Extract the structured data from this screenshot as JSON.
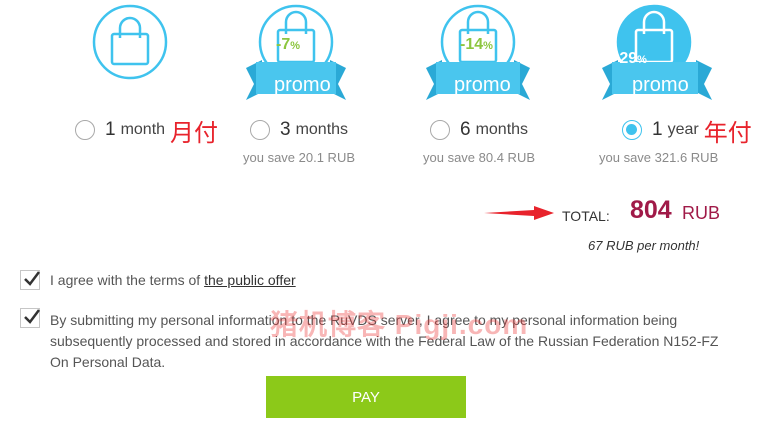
{
  "plans": [
    {
      "number": "1",
      "unit": "month",
      "note": "月付",
      "discount": "",
      "promo": "",
      "savings": "",
      "selected": false
    },
    {
      "number": "3",
      "unit": "months",
      "note": "",
      "discount": "-7",
      "promo": "promo",
      "savings": "you save 20.1 RUB",
      "selected": false
    },
    {
      "number": "6",
      "unit": "months",
      "note": "",
      "discount": "-14",
      "promo": "promo",
      "savings": "you save 80.4 RUB",
      "selected": false
    },
    {
      "number": "1",
      "unit": "year",
      "note": "年付",
      "discount": "-29",
      "promo": "promo",
      "savings": "you save 321.6 RUB",
      "selected": true
    }
  ],
  "percent_sign": "%",
  "total": {
    "label": "TOTAL:",
    "amount": "804",
    "currency": "RUB",
    "per_month": "67 RUB per month!"
  },
  "agreements": {
    "terms_text": "I agree with the terms of ",
    "terms_link": "the public offer",
    "consent_text": "By submitting my personal information to the RuVDS server, I agree to my personal information being subsequently processed and stored in accordance with the Federal Law of the Russian Federation N152-FZ On Personal Data.",
    "terms_checked": true,
    "consent_checked": true
  },
  "watermark": "猪机博客 Pigji.com",
  "pay_label": "PAY",
  "colors": {
    "accent": "#3fc3ee",
    "price": "#a01a48",
    "pay": "#8cc919",
    "discount": "#8cc63f",
    "annotation": "#e8232c"
  }
}
